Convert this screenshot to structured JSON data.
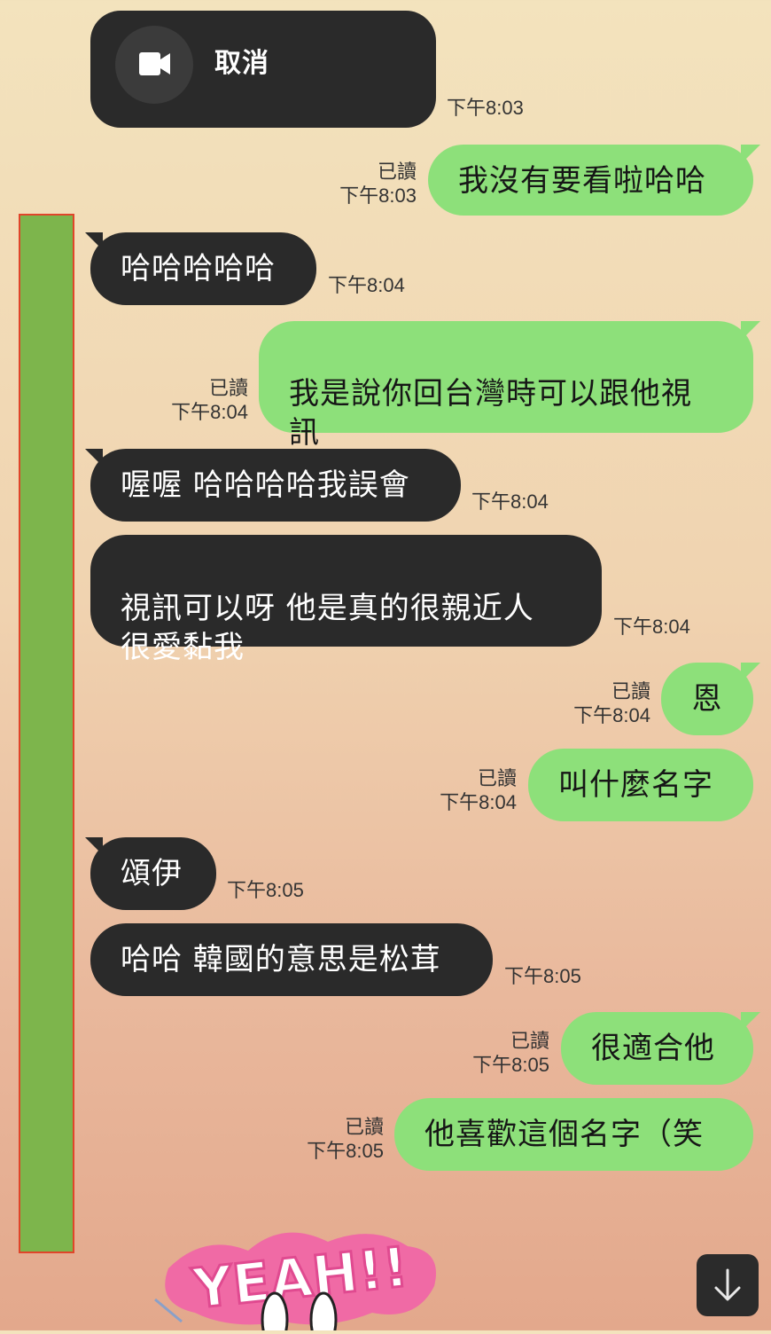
{
  "call_card": {
    "label": "取消",
    "icon": "video-camera-icon",
    "time": "下午8:03"
  },
  "messages": [
    {
      "dir": "out",
      "text": "我沒有要看啦哈哈",
      "read": "已讀",
      "time": "下午8:03"
    },
    {
      "dir": "in",
      "text": "哈哈哈哈哈",
      "time": "下午8:04"
    },
    {
      "dir": "out",
      "text": "我是說你回台灣時可以跟他視\n訊",
      "read": "已讀",
      "time": "下午8:04"
    },
    {
      "dir": "in",
      "text": "喔喔 哈哈哈哈我誤會",
      "time": "下午8:04"
    },
    {
      "dir": "in",
      "text": "視訊可以呀 他是真的很親近人\n很愛黏我",
      "time": "下午8:04"
    },
    {
      "dir": "out",
      "text": "恩",
      "read": "已讀",
      "time": "下午8:04"
    },
    {
      "dir": "out",
      "text": "叫什麼名字",
      "read": "已讀",
      "time": "下午8:04"
    },
    {
      "dir": "in",
      "text": "頌伊",
      "time": "下午8:05"
    },
    {
      "dir": "in",
      "text": "哈哈 韓國的意思是松茸",
      "time": "下午8:05"
    },
    {
      "dir": "out",
      "text": "很適合他",
      "read": "已讀",
      "time": "下午8:05"
    },
    {
      "dir": "out",
      "text": "他喜歡這個名字（笑",
      "read": "已讀",
      "time": "下午8:05"
    }
  ],
  "sticker": {
    "text": "YEAH!!",
    "icon": "bunny-sticker-icon"
  },
  "scroll_button": {
    "icon": "arrow-down-icon"
  },
  "colors": {
    "outgoing": "#8de07a",
    "incoming": "#2a2a2a",
    "redaction": "#7db54c"
  }
}
